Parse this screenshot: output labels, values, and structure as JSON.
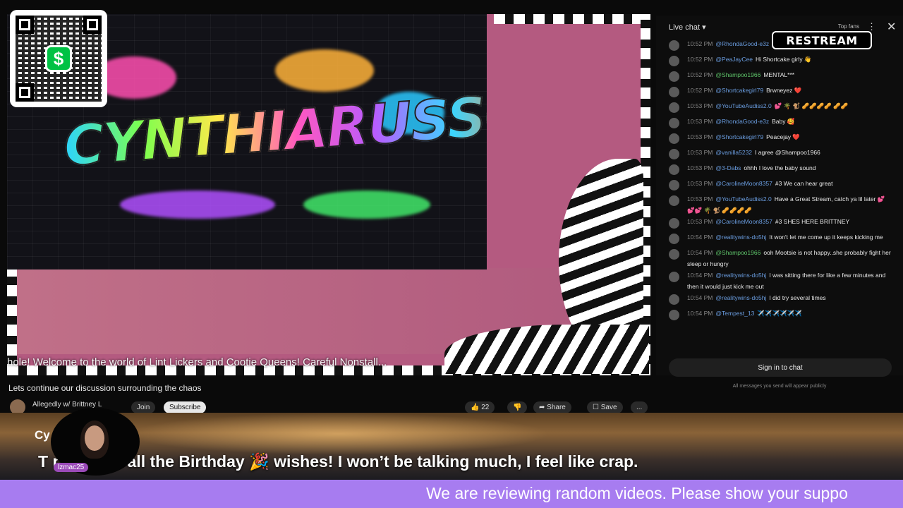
{
  "video": {
    "banner_text": "CYNTHIARUSSO",
    "qr_symbol": "$",
    "scrolling_text": "hole!        Welcome to the world of Lint Lickers and Cootie Queens! Careful Nonstall..."
  },
  "below_video": {
    "title": "Lets continue our discussion surrounding the chaos",
    "channel_name": "Allegedly w/ Brittney L",
    "join_label": "Join",
    "subscribe_label": "Subscribe",
    "likes": "22",
    "share_label": "Share",
    "save_label": "Save",
    "more_label": "..."
  },
  "chat": {
    "header": "Live chat",
    "top_fans": "Top fans",
    "more": "⋮",
    "close": "✕",
    "restream_logo": "RESTREAM",
    "messages": [
      {
        "time": "10:52 PM",
        "user": "@RhondaGood-e3z",
        "text": "",
        "green": false
      },
      {
        "time": "10:52 PM",
        "user": "@PeaJayCee",
        "text": "Hi Shortcake girly 👋",
        "green": false
      },
      {
        "time": "10:52 PM",
        "user": "@Shampoo1966",
        "text": "MENTAL***",
        "green": true
      },
      {
        "time": "10:52 PM",
        "user": "@Shortcakegirl79",
        "text": "Brwneyez ❤️",
        "green": false
      },
      {
        "time": "10:53 PM",
        "user": "@YouTubeAudiss2.0",
        "text": "💕 🌴 🐒 🥜🥜🥜🥜 🥜🥜",
        "green": false
      },
      {
        "time": "10:53 PM",
        "user": "@RhondaGood-e3z",
        "text": "Baby 🥰",
        "green": false
      },
      {
        "time": "10:53 PM",
        "user": "@Shortcakegirl79",
        "text": "Peacejay ❤️",
        "green": false
      },
      {
        "time": "10:53 PM",
        "user": "@vanilla5232",
        "text": "I agree @Shampoo1966",
        "green": false
      },
      {
        "time": "10:53 PM",
        "user": "@3-Dabs",
        "text": "ohhh I love the baby sound",
        "green": false
      },
      {
        "time": "10:53 PM",
        "user": "@CarolineMoon8357",
        "text": "#3  We can hear great",
        "green": false
      },
      {
        "time": "10:53 PM",
        "user": "@YouTubeAudiss2.0",
        "text": "Have a Great Stream, catch ya lil later 💕💕💕 🌴 🐒 🥜🥜🥜🥜",
        "green": false
      },
      {
        "time": "10:53 PM",
        "user": "@CarolineMoon8357",
        "text": "#3  SHES HERE BRITTNEY",
        "green": false
      },
      {
        "time": "10:54 PM",
        "user": "@realitywins-do5hj",
        "text": "It won't let me come up it keeps kicking me",
        "green": false
      },
      {
        "time": "10:54 PM",
        "user": "@Shampoo1966",
        "text": "ooh Mootsie is not happy..she probably fight her sleep or hungry",
        "green": true
      },
      {
        "time": "10:54 PM",
        "user": "@realitywins-do5hj",
        "text": "I was sitting there for like a few minutes and then it would just kick me out",
        "green": false
      },
      {
        "time": "10:54 PM",
        "user": "@realitywins-do5hj",
        "text": "I did try several times",
        "green": false
      },
      {
        "time": "10:54 PM",
        "user": "@Tempest_13",
        "text": "✈️✈️✈️✈️✈️✈️",
        "green": false
      }
    ],
    "signin_label": "Sign in to chat",
    "note": "All messages you send will appear publicly"
  },
  "overlay": {
    "streamer_name": "Cy          usso",
    "announcement": "T               ryone for all the Birthday 🎉 wishes! I won’t be talking much, I feel like crap.",
    "user_tag": "lzmac25",
    "ticker_text": "We are reviewing random videos. Please show your suppo"
  }
}
